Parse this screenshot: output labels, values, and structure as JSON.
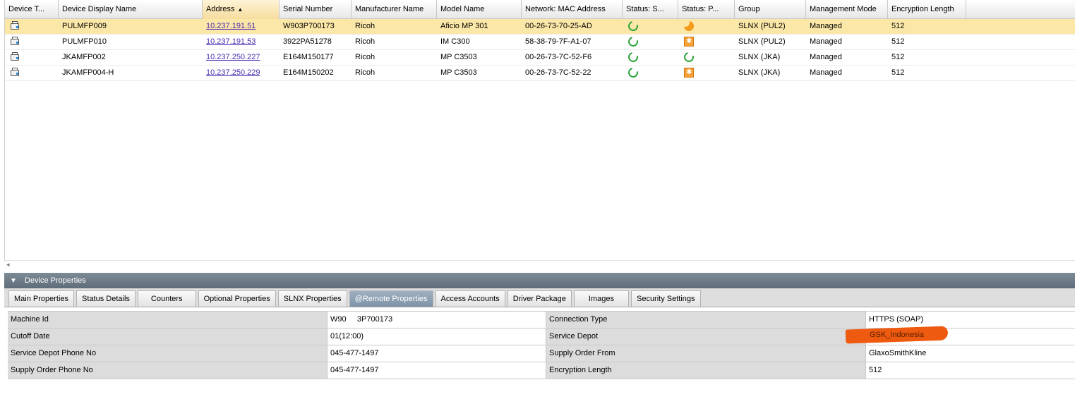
{
  "grid": {
    "columns": [
      "Device T...",
      "Device Display Name",
      "Address",
      "Serial Number",
      "Manufacturer Name",
      "Model Name",
      "Network: MAC Address",
      "Status: S...",
      "Status: P...",
      "Group",
      "Management Mode",
      "Encryption Length"
    ],
    "sorted_column": "Address",
    "rows": [
      {
        "name": "PULMFP009",
        "address": "10.237.191.51",
        "serial": "W903P700173",
        "manufacturer": "Ricoh",
        "model": "Aficio MP 301",
        "mac": "00-26-73-70-25-AD",
        "status_s": "ok-icon",
        "status_p": "sleep-icon",
        "group": "SLNX (PUL2)",
        "mode": "Managed",
        "encryption": "512",
        "selected": true
      },
      {
        "name": "PULMFP010",
        "address": "10.237.191.53",
        "serial": "3922PA51278",
        "manufacturer": "Ricoh",
        "model": "IM C300",
        "mac": "58-38-79-7F-A1-07",
        "status_s": "ok-icon",
        "status_p": "warning-icon",
        "group": "SLNX (PUL2)",
        "mode": "Managed",
        "encryption": "512",
        "selected": false
      },
      {
        "name": "JKAMFP002",
        "address": "10.237.250.227",
        "serial": "E164M150177",
        "manufacturer": "Ricoh",
        "model": "MP C3503",
        "mac": "00-26-73-7C-52-F6",
        "status_s": "ok-icon",
        "status_p": "ok-icon",
        "group": "SLNX (JKA)",
        "mode": "Managed",
        "encryption": "512",
        "selected": false
      },
      {
        "name": "JKAMFP004-H",
        "address": "10.237.250.229",
        "serial": "E164M150202",
        "manufacturer": "Ricoh",
        "model": "MP C3503",
        "mac": "00-26-73-7C-52-22",
        "status_s": "ok-icon",
        "status_p": "warning-icon",
        "group": "SLNX (JKA)",
        "mode": "Managed",
        "encryption": "512",
        "selected": false
      }
    ]
  },
  "panel": {
    "title": "Device Properties",
    "tabs": [
      "Main Properties",
      "Status Details",
      "Counters",
      "Optional Properties",
      "SLNX Properties",
      "@Remote Properties",
      "Access Accounts",
      "Driver Package",
      "Images",
      "Security Settings"
    ],
    "active_tab": "@Remote Properties",
    "properties": [
      {
        "label1": "Machine Id",
        "value1": "W90     3P700173",
        "label2": "Connection Type",
        "value2": "HTTPS (SOAP)"
      },
      {
        "label1": "Cutoff Date",
        "value1": "01(12:00)",
        "label2": "Service Depot",
        "value2": "GSK_Indonesia"
      },
      {
        "label1": "Service Depot Phone No",
        "value1": "045-477-1497",
        "label2": "Supply Order From",
        "value2": "GlaxoSmithKline"
      },
      {
        "label1": "Supply Order Phone No",
        "value1": "045-477-1497",
        "label2": "Encryption Length",
        "value2": "512"
      }
    ]
  },
  "colors": {
    "selected_row": "#fbe7a8",
    "link": "#4a2bb0",
    "status_ok": "#27a33a",
    "status_orange": "#f39b1a",
    "redaction": "#ee5a0f"
  }
}
